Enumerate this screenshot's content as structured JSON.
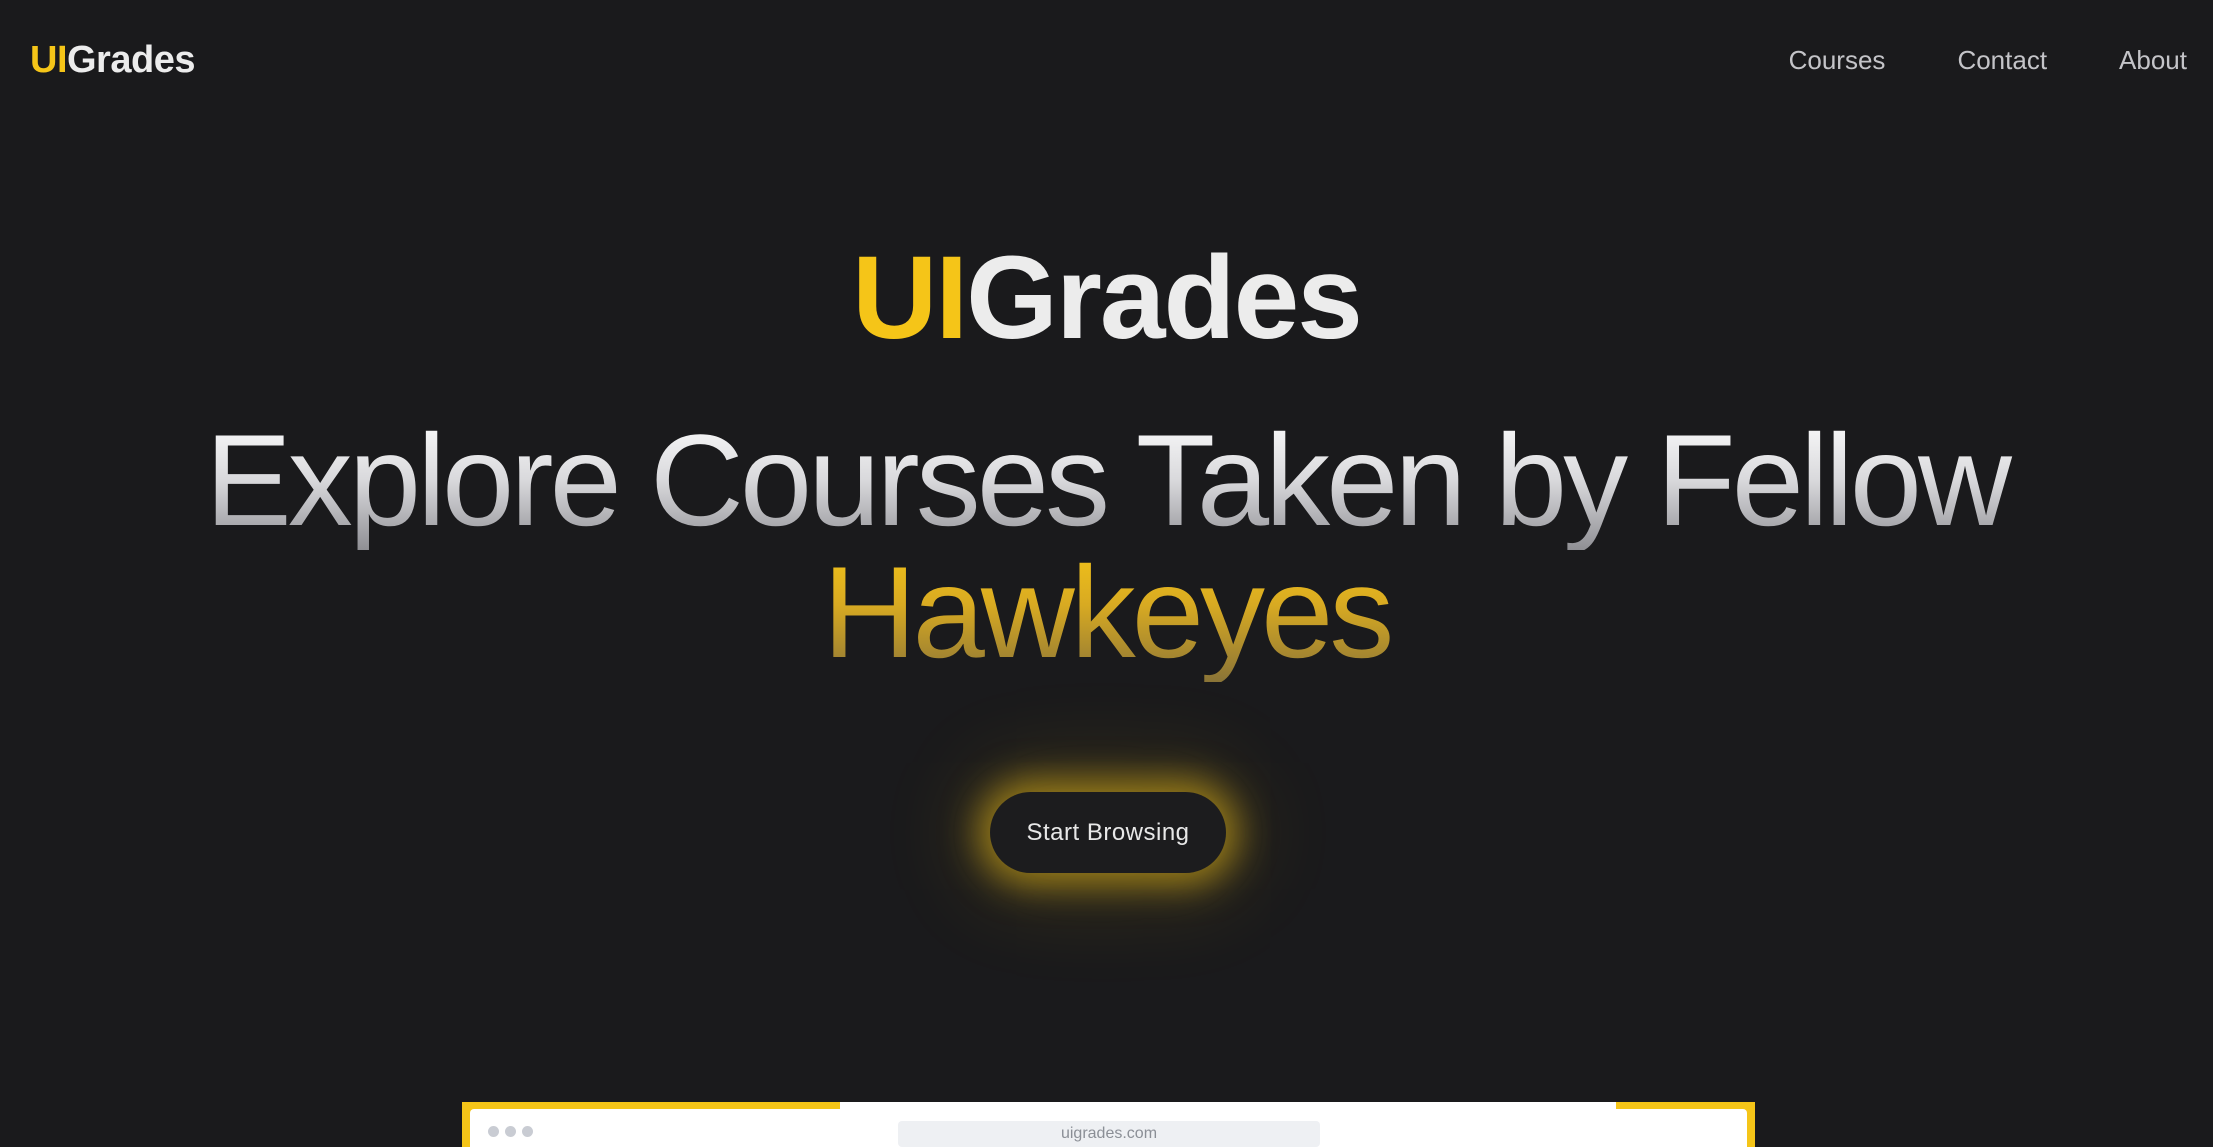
{
  "nav": {
    "logo_accent": "UI",
    "logo_rest": "Grades",
    "links": [
      {
        "label": "Courses"
      },
      {
        "label": "Contact"
      },
      {
        "label": "About"
      }
    ]
  },
  "hero": {
    "brand_accent": "UI",
    "brand_rest": "Grades",
    "headline_line1": "Explore Courses Taken by Fellow",
    "headline_line2": "Hawkeyes",
    "cta_label": "Start Browsing"
  },
  "preview": {
    "url": "uigrades.com"
  },
  "colors": {
    "background": "#1a1a1c",
    "accent": "#f5c518",
    "text": "#ececec"
  }
}
